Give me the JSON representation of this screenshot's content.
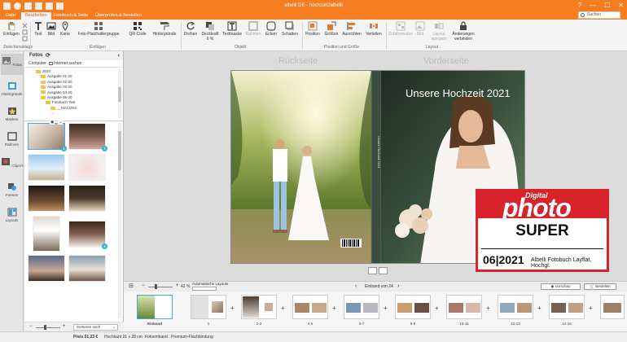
{
  "app": {
    "title": "albelli DE - hochzeit2albelli",
    "search_placeholder": "Suchen",
    "window_controls": [
      "?",
      "—",
      "☐",
      "✕"
    ]
  },
  "tabs": [
    {
      "label": "Datei",
      "active": false
    },
    {
      "label": "Bearbeiten",
      "active": true
    },
    {
      "label": "Fotobuch & Seite",
      "active": false
    },
    {
      "label": "Überprüfen & Bestellen",
      "active": false
    }
  ],
  "ribbon": {
    "insert": {
      "label": "Einfügen",
      "group": "Zwischenablage"
    },
    "text": "Text",
    "bild": "Bild",
    "karte": "Karte",
    "foto_platzhalter": "Foto-Platzhaltergruppe",
    "qr_code": "QR-Code",
    "hintergruende": "Hintergründe",
    "group_einfuegen": "Einfügen",
    "drehen": "Drehen",
    "deckkraft": "Deckkraft",
    "deckkraft_value": "0 %",
    "textmaske": "Textmaske",
    "rahmen": "Rahmen",
    "ecken": "Ecken",
    "schatten": "Schatten",
    "group_objekt": "Objekt",
    "position": "Position",
    "groessen": "Größen",
    "ausrichten": "Ausrichten",
    "verteilen": "Verteilen",
    "group_position": "Position und Größe",
    "zufallsmodus": "Zufallsmodus",
    "bild2": "Bild",
    "layout_spiegeln": "Layout spiegeln",
    "aenderungen": "Änderungen verbinden",
    "group_layout": "Layout"
  },
  "sidebar_tools": [
    {
      "label": "Fotos",
      "icon": "photos-icon",
      "active": true
    },
    {
      "label": "Hintergründe",
      "icon": "backgrounds-icon",
      "active": false
    },
    {
      "label": "Masken",
      "icon": "masks-icon",
      "active": false
    },
    {
      "label": "Rahmen",
      "icon": "frames-icon",
      "active": false
    },
    {
      "label": "ClipArt",
      "icon": "clipart-icon",
      "active": false
    },
    {
      "label": "Formen",
      "icon": "shapes-icon",
      "active": false
    },
    {
      "label": "Layouts",
      "icon": "layouts-icon",
      "active": false
    }
  ],
  "photos_panel": {
    "title": "Fotos",
    "source_computer": "Computer",
    "source_internet": "Internet suchen",
    "folders": [
      "2020",
      "Ausgabe 01-20",
      "Ausgabe 02-20",
      "Ausgabe 03-20",
      "Ausgabe 04-20",
      "Ausgabe 05-20",
      "Fotobuch-Test",
      "__MACOSX",
      "…"
    ],
    "sort_label": "Sortieren nach",
    "badge_count": "1"
  },
  "canvas": {
    "back_label": "Rückseite",
    "front_label": "Vorderseite",
    "cover_title": "Unsere Hochzeit 2021",
    "spine_text": "Unsere Hochzeit 2021"
  },
  "timeline": {
    "zoom_label": "42 %",
    "auto_layout": "Automatische Layouts",
    "cover_count": "Einband von 24",
    "preview": "Vorschau",
    "order": "Bestellen",
    "pages": [
      "Einband",
      "1",
      "2-3",
      "4-5",
      "6-7",
      "8-9",
      "10-11",
      "12-13",
      "14-15"
    ]
  },
  "status": {
    "price": "Preis 51,23 €",
    "format": "Hochkant 21 x 28 cm",
    "binding": "Fotoeinband",
    "paper": "Premium-Flachbindung"
  },
  "award": {
    "digital": "Digital",
    "photo": "photo",
    "super": "SUPER",
    "date": "06|2021",
    "product": "Albelli Fotobuch Layflat, Hochgl."
  }
}
